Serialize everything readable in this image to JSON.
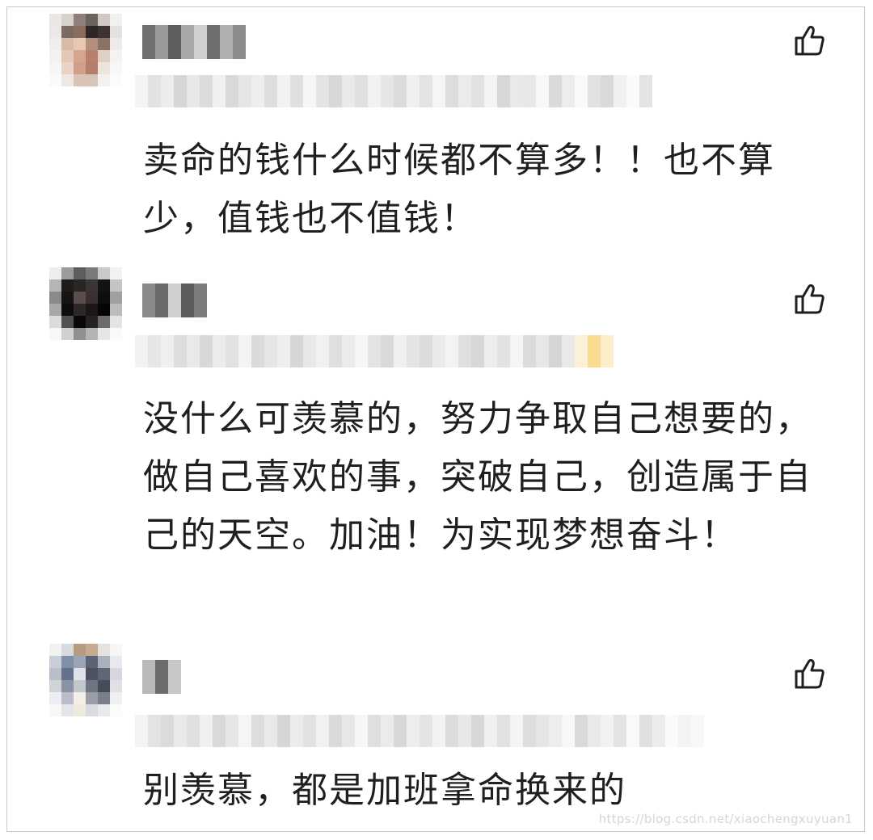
{
  "comments": [
    {
      "text": "卖命的钱什么时候都不算多！！也不算少，值钱也不值钱！",
      "like_icon": "thumbs-up-icon"
    },
    {
      "text": "没什么可羡慕的，努力争取自己想要的，做自己喜欢的事，突破自己，创造属于自己的天空。加油！为实现梦想奋斗！",
      "like_icon": "thumbs-up-icon"
    },
    {
      "text": "别羡慕，都是加班拿命换来的",
      "like_icon": "thumbs-up-icon"
    }
  ],
  "watermark": "https://blog.csdn.net/xiaochengxuyuan1"
}
